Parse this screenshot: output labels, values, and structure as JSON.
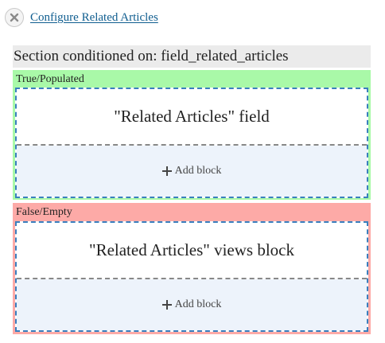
{
  "toolbar": {
    "close_icon": "close-x-icon",
    "configure_link": "Configure Related Articles"
  },
  "section": {
    "header": "Section conditioned on: field_related_articles"
  },
  "conditions": [
    {
      "label": "True/Populated",
      "color": "#a9f9a8",
      "block_title": "\"Related Articles\" field",
      "add_block_label": "Add block"
    },
    {
      "label": "False/Empty",
      "color": "#fdaaa7",
      "block_title": "\"Related Articles\" views block",
      "add_block_label": "Add block"
    }
  ],
  "colors": {
    "link": "#0f5d8f",
    "header_bg": "#ebebeb",
    "dashed_border": "#3a7fbe",
    "add_area_bg": "#edf3fb"
  }
}
